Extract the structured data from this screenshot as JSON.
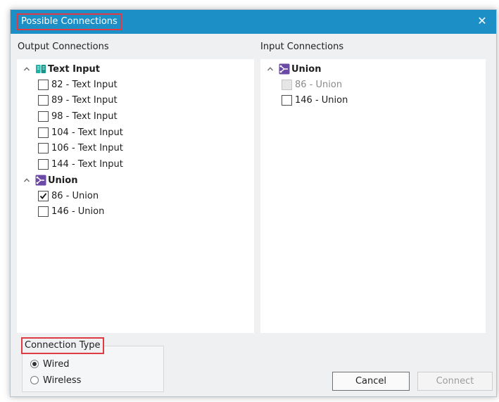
{
  "dialog": {
    "title": "Possible Connections",
    "close_glyph": "✕",
    "accent_color": "#1b8fc6"
  },
  "output": {
    "header": "Output Connections",
    "groups": [
      {
        "label": "Text Input",
        "icon": "text-input-icon",
        "expanded": true,
        "items": [
          {
            "label": "82 - Text Input",
            "checked": false
          },
          {
            "label": "89 - Text Input",
            "checked": false
          },
          {
            "label": "98 - Text Input",
            "checked": false
          },
          {
            "label": "104 - Text Input",
            "checked": false
          },
          {
            "label": "106 - Text Input",
            "checked": false
          },
          {
            "label": "144 - Text Input",
            "checked": false
          }
        ]
      },
      {
        "label": "Union",
        "icon": "union-icon",
        "expanded": true,
        "items": [
          {
            "label": "86 - Union",
            "checked": true
          },
          {
            "label": "146 - Union",
            "checked": false
          }
        ]
      }
    ]
  },
  "input": {
    "header": "Input Connections",
    "groups": [
      {
        "label": "Union",
        "icon": "union-icon",
        "expanded": true,
        "items": [
          {
            "label": "86 - Union",
            "checked": false,
            "disabled": true
          },
          {
            "label": "146 - Union",
            "checked": false
          }
        ]
      }
    ]
  },
  "connection_type": {
    "label": "Connection Type",
    "options": [
      {
        "label": "Wired",
        "selected": true
      },
      {
        "label": "Wireless",
        "selected": false
      }
    ]
  },
  "buttons": {
    "cancel": "Cancel",
    "connect": "Connect",
    "connect_enabled": false
  }
}
